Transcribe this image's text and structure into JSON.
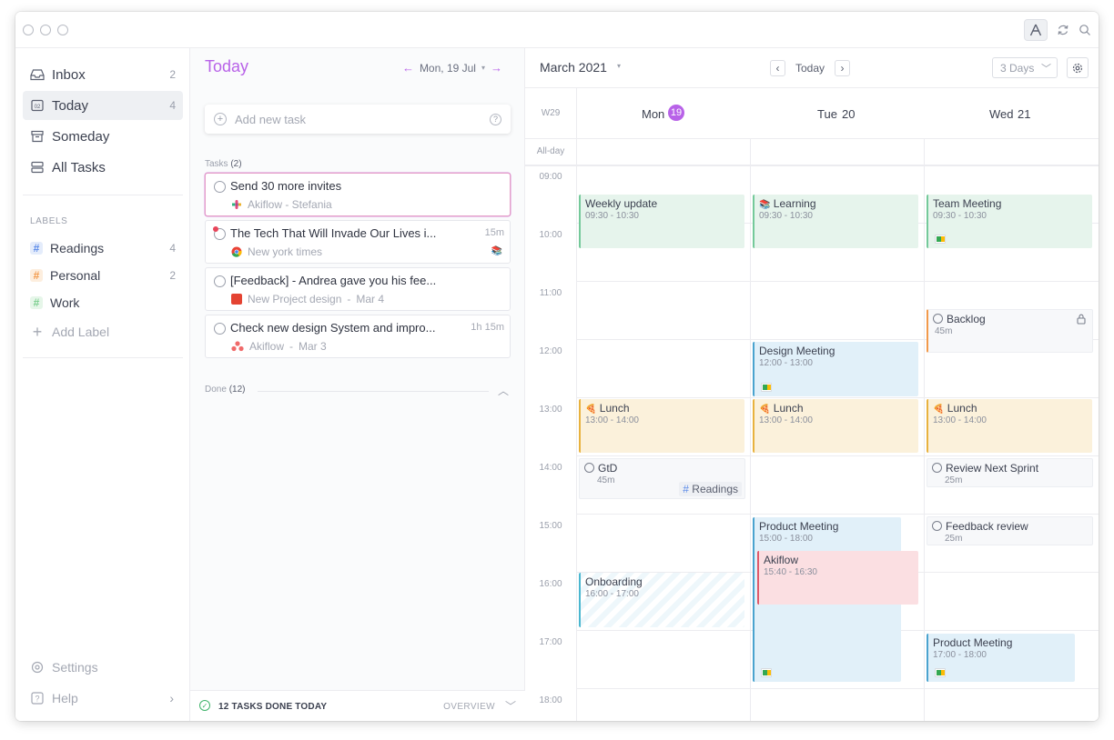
{
  "sidebar": {
    "nav": [
      {
        "label": "Inbox",
        "count": "2",
        "icon": "inbox-icon"
      },
      {
        "label": "Today",
        "count": "4",
        "icon": "calendar-day-icon"
      },
      {
        "label": "Someday",
        "count": "",
        "icon": "archive-box-icon"
      },
      {
        "label": "All Tasks",
        "count": "",
        "icon": "stack-icon"
      }
    ],
    "labels_heading": "LABELS",
    "labels": [
      {
        "label": "Readings",
        "count": "4",
        "color": "#5b8ae8"
      },
      {
        "label": "Personal",
        "count": "2",
        "color": "#f2994a"
      },
      {
        "label": "Work",
        "count": "",
        "color": "#7ccf8f"
      }
    ],
    "add_label": "Add Label",
    "settings": "Settings",
    "help": "Help"
  },
  "tasks_panel": {
    "title": "Today",
    "date": "Mon, 19 Jul",
    "add_placeholder": "Add new task",
    "tasks_label": "Tasks",
    "tasks_count": "(2)",
    "tasks": [
      {
        "title": "Send 30 more invites",
        "duration": "",
        "meta": "Akiflow - Stefania",
        "source": "slack-icon"
      },
      {
        "title": "The Tech That Will Invade Our Lives i...",
        "duration": "15m",
        "meta": "New york times",
        "source": "chrome-icon"
      },
      {
        "title": "[Feedback] - Andrea gave you his fee...",
        "duration": "",
        "meta": "New Project design",
        "meta_date": "Mar 4",
        "source": "todoist-icon"
      },
      {
        "title": "Check new design System and impro...",
        "duration": "1h 15m",
        "meta": "Akiflow",
        "meta_date": "Mar 3",
        "source": "asana-icon"
      }
    ],
    "done_label": "Done",
    "done_count": "(12)",
    "footer_done": "12 TASKS DONE TODAY",
    "footer_overview": "OVERVIEW"
  },
  "calendar": {
    "month": "March 2021",
    "today_btn": "Today",
    "view": "3 Days",
    "week": "W29",
    "allday": "All-day",
    "days": [
      {
        "name": "Mon",
        "num": "19",
        "today": true
      },
      {
        "name": "Tue",
        "num": "20",
        "today": false
      },
      {
        "name": "Wed",
        "num": "21",
        "today": false
      }
    ],
    "hours": [
      "09:00",
      "10:00",
      "11:00",
      "12:00",
      "13:00",
      "14:00",
      "15:00",
      "16:00",
      "17:00",
      "18:00"
    ],
    "events": {
      "weekly_update": {
        "title": "Weekly update",
        "time": "09:30 - 10:30"
      },
      "learning": {
        "title": "Learning",
        "time": "09:30 - 10:30"
      },
      "team_meeting": {
        "title": "Team Meeting",
        "time": "09:30 - 10:30"
      },
      "backlog": {
        "title": "Backlog",
        "time": "45m"
      },
      "design_meeting": {
        "title": "Design Meeting",
        "time": "12:00 - 13:00"
      },
      "lunch": {
        "title": "Lunch",
        "time": "13:00 - 14:00"
      },
      "gtd": {
        "title": "GtD",
        "time": "45m",
        "tag": "Readings"
      },
      "review_sprint": {
        "title": "Review Next Sprint",
        "time": "25m"
      },
      "product_meeting_tue": {
        "title": "Product Meeting",
        "time": "15:00 - 18:00"
      },
      "akiflow": {
        "title": "Akiflow",
        "time": "15:40 - 16:30"
      },
      "feedback_review": {
        "title": "Feedback review",
        "time": "25m"
      },
      "onboarding": {
        "title": "Onboarding",
        "time": "16:00 - 17:00"
      },
      "product_meeting_wed": {
        "title": "Product Meeting",
        "time": "17:00 - 18:00"
      }
    }
  }
}
